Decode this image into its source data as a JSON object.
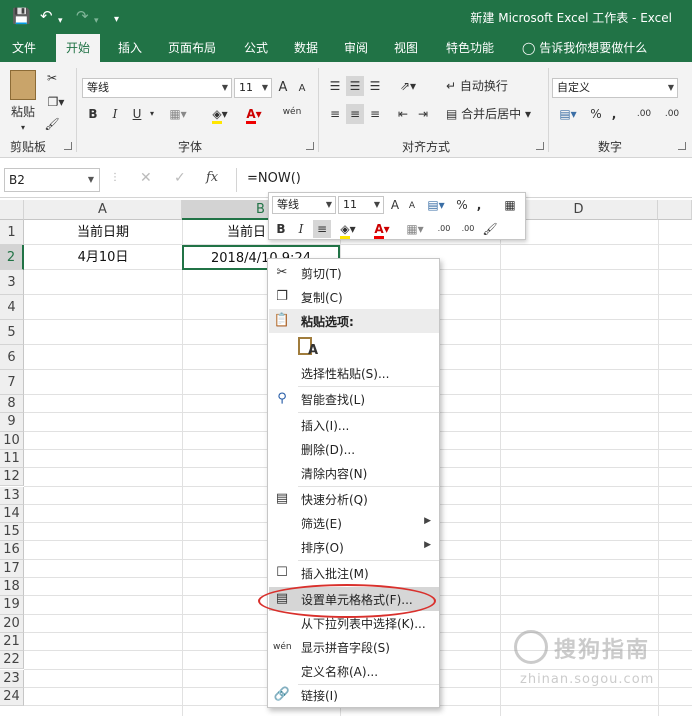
{
  "window": {
    "title": "新建 Microsoft Excel 工作表  -  Excel"
  },
  "tabs": [
    {
      "label": "文件"
    },
    {
      "label": "开始"
    },
    {
      "label": "插入"
    },
    {
      "label": "页面布局"
    },
    {
      "label": "公式"
    },
    {
      "label": "数据"
    },
    {
      "label": "审阅"
    },
    {
      "label": "视图"
    },
    {
      "label": "特色功能"
    },
    {
      "label": "告诉我你想要做什么"
    }
  ],
  "ribbon": {
    "clipboard": {
      "paste_label": "粘贴",
      "group_label": "剪贴板"
    },
    "font": {
      "font_name": "等线",
      "font_size": "11",
      "grow": "A",
      "shrink": "A",
      "bold": "B",
      "italic": "I",
      "underline": "U",
      "phonetic": "wén",
      "group_label": "字体"
    },
    "alignment": {
      "wrap_text": "自动换行",
      "merge_center": "合并后居中",
      "group_label": "对齐方式"
    },
    "number": {
      "format": "自定义",
      "percent": "%",
      "comma": ",",
      "inc_decimal": ".00",
      "dec_decimal": ".00",
      "group_label": "数字"
    }
  },
  "formula_bar": {
    "name_box": "B2",
    "fx": "fx",
    "formula": "=NOW()"
  },
  "grid": {
    "columns": [
      "A",
      "B",
      "D"
    ],
    "rows": [
      "1",
      "2",
      "3",
      "4",
      "5",
      "6",
      "7",
      "8",
      "9",
      "10",
      "11",
      "12",
      "13",
      "14",
      "15",
      "16",
      "17",
      "18",
      "19",
      "20",
      "21",
      "22",
      "23",
      "24"
    ],
    "cells": {
      "a1": "当前日期",
      "b1": "当前日",
      "a2": "4月10日",
      "b2": "2018/4/10 9:24"
    }
  },
  "mini_toolbar": {
    "font_name": "等线",
    "font_size": "11",
    "grow": "A",
    "shrink": "A",
    "percent": "%",
    "comma": ",",
    "bold": "B",
    "italic": "I",
    "inc_decimal": ".00",
    "dec_decimal": ".00"
  },
  "context_menu": {
    "cut": "剪切(T)",
    "copy": "复制(C)",
    "paste_options": "粘贴选项:",
    "paste_special": "选择性粘贴(S)...",
    "smart_lookup": "智能查找(L)",
    "insert": "插入(I)...",
    "delete": "删除(D)...",
    "clear": "清除内容(N)",
    "quick_analysis": "快速分析(Q)",
    "filter": "筛选(E)",
    "sort": "排序(O)",
    "insert_comment": "插入批注(M)",
    "format_cells": "设置单元格格式(F)...",
    "pick_from_list": "从下拉列表中选择(K)...",
    "phonetic": "显示拼音字段(S)",
    "define_name": "定义名称(A)...",
    "link": "链接(I)"
  },
  "watermark": {
    "brand": "搜狗指南",
    "url": "zhinan.sogou.com"
  },
  "colors": {
    "excel_green": "#217346",
    "highlight_circle": "#d9302c"
  }
}
